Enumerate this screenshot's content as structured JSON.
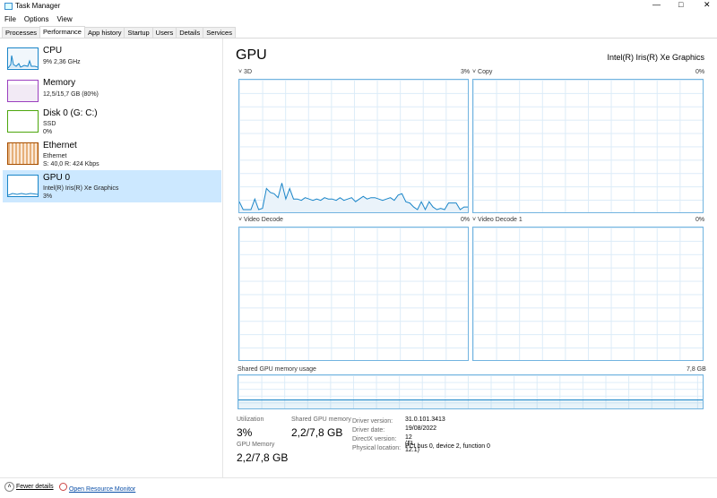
{
  "window": {
    "title": "Task Manager"
  },
  "menu": [
    "File",
    "Options",
    "View"
  ],
  "tabs": [
    "Processes",
    "Performance",
    "App history",
    "Startup",
    "Users",
    "Details",
    "Services"
  ],
  "active_tab": "Performance",
  "sidebar": [
    {
      "title": "CPU",
      "line1": "9%  2,36 GHz",
      "color": "#1a85c8"
    },
    {
      "title": "Memory",
      "line1": "12,5/15,7 GB (80%)",
      "color": "#9b3fbf"
    },
    {
      "title": "Disk 0 (G: C:)",
      "line1": "SSD",
      "line2": "0%",
      "color": "#4da60c"
    },
    {
      "title": "Ethernet",
      "line1": "Ethernet",
      "line2": "S: 40,0  R: 424 Kbps",
      "color": "#a74f01"
    },
    {
      "title": "GPU 0",
      "line1": "Intel(R) Iris(R) Xe Graphics",
      "line2": "3%",
      "color": "#1a85c8"
    }
  ],
  "main": {
    "title": "GPU",
    "device": "Intel(R) Iris(R) Xe Graphics",
    "graphs": [
      {
        "label": "3D",
        "value": "3%"
      },
      {
        "label": "Copy",
        "value": "0%"
      },
      {
        "label": "Video Decode",
        "value": "0%"
      },
      {
        "label": "Video Decode 1",
        "value": "0%"
      }
    ],
    "shared_label": "Shared GPU memory usage",
    "shared_max": "7,8 GB",
    "stats": {
      "utilization_label": "Utilization",
      "utilization": "3%",
      "shared_label": "Shared GPU memory",
      "shared": "2,2/7,8 GB",
      "gpu_mem_label": "GPU Memory",
      "gpu_mem": "2,2/7,8 GB"
    },
    "info": [
      {
        "k": "Driver version:",
        "v": "31.0.101.3413"
      },
      {
        "k": "Driver date:",
        "v": "19/08/2022"
      },
      {
        "k": "DirectX version:",
        "v": "12 (FL 12.1)"
      },
      {
        "k": "Physical location:",
        "v": "PCI bus 0, device 2, function 0"
      }
    ],
    "util_history_3d": [
      8,
      2,
      2,
      2,
      10,
      2,
      3,
      18,
      15,
      14,
      11,
      22,
      10,
      18,
      10,
      10,
      9,
      11,
      10,
      9,
      10,
      9,
      11,
      10,
      10,
      9,
      11,
      9,
      10,
      11,
      8,
      10,
      12,
      10,
      11,
      11,
      10,
      9,
      10,
      11,
      9,
      13,
      14,
      8,
      7,
      4,
      2,
      8,
      2,
      8,
      4,
      2,
      3,
      2,
      7,
      7,
      7,
      2,
      4,
      4
    ],
    "shared_history_pct": 28
  },
  "footer": {
    "fewer": "Fewer details",
    "monitor": "Open Resource Monitor"
  },
  "colors": {
    "accent": "#1a85c8",
    "selected": "#cce8ff"
  }
}
